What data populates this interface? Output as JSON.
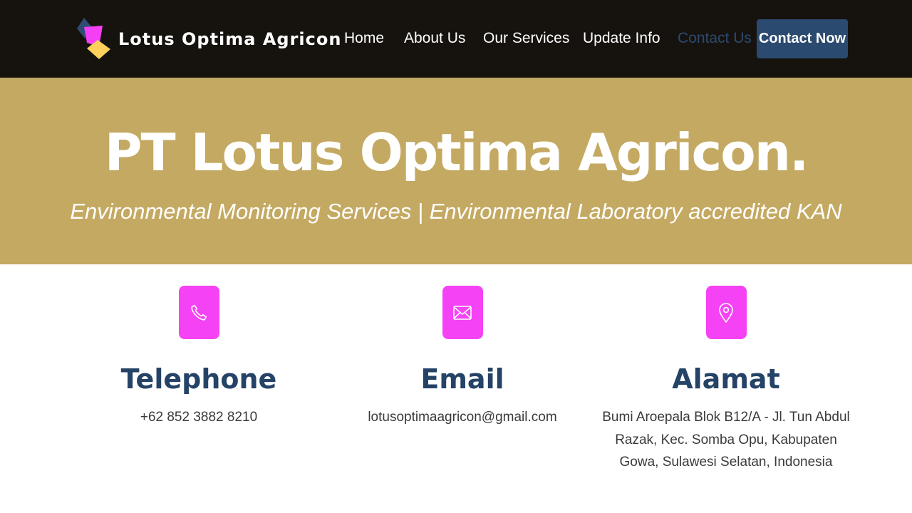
{
  "brand": {
    "name": "Lotus Optima Agricon"
  },
  "nav": {
    "items": [
      {
        "label": "Home"
      },
      {
        "label": "About Us"
      },
      {
        "label": "Our Services"
      },
      {
        "label": "Update Info"
      },
      {
        "label": "Contact Us",
        "active": true
      }
    ],
    "cta_label": "Contact Now"
  },
  "hero": {
    "title": "PT Lotus Optima Agricon.",
    "subtitle": "Environmental Monitoring Services | Environmental Laboratory accredited KAN"
  },
  "contact": [
    {
      "icon": "phone-icon",
      "title": "Telephone",
      "text": "+62 852 3882 8210"
    },
    {
      "icon": "mail-icon",
      "title": "Email",
      "text": "lotusoptimaagricon@gmail.com"
    },
    {
      "icon": "location-pin-icon",
      "title": "Alamat",
      "text": "Bumi Aroepala Blok B12/A - Jl. Tun Abdul Razak, Kec. Somba Opu, Kabupaten Gowa, Sulawesi Selatan, Indonesia"
    }
  ],
  "colors": {
    "navbar_bg": "#16120e",
    "hero_bg": "#c4a962",
    "accent_blue": "#2b4a6f",
    "icon_bg": "#f542f5"
  }
}
